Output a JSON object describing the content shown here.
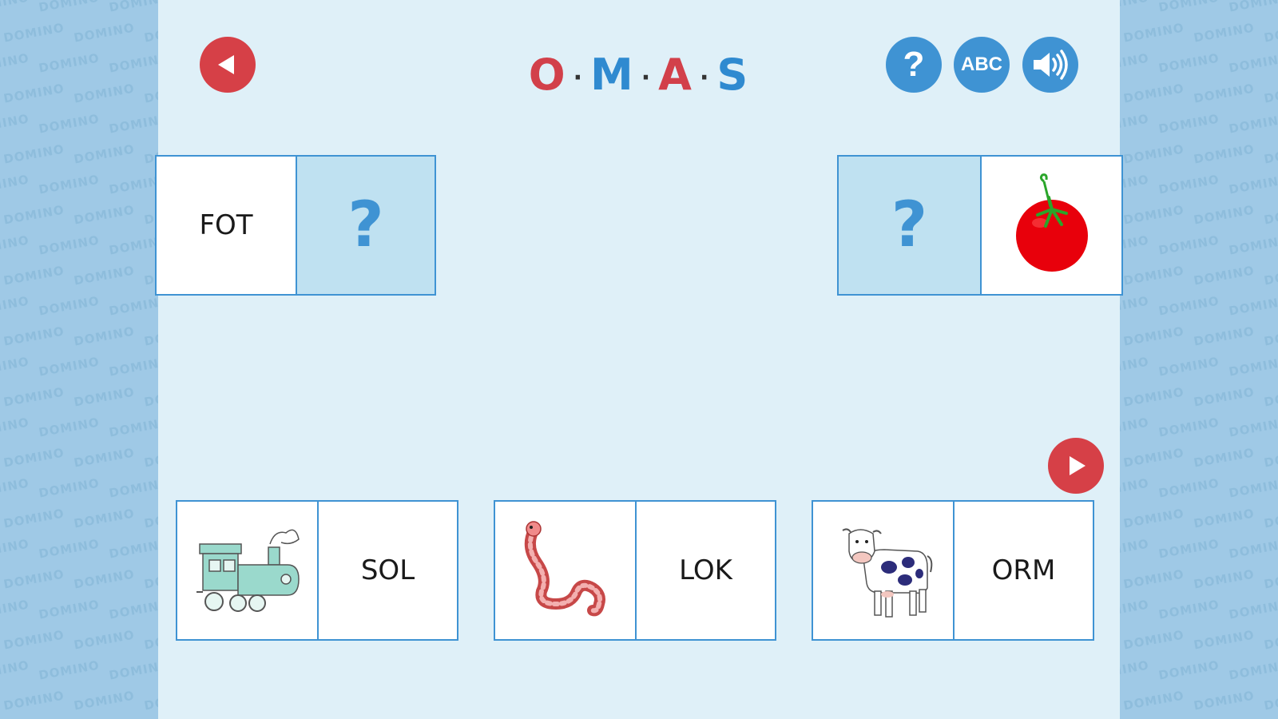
{
  "background": {
    "watermark_text": "DOMINO",
    "colors": {
      "side_panel": "#9fc9e6",
      "main_panel": "#dff0f8",
      "accent_blue": "#3f93d3",
      "accent_red": "#d64047"
    }
  },
  "header": {
    "back_icon": "triangle-left-icon",
    "title_letters": [
      "O",
      "M",
      "A",
      "S"
    ],
    "title_separator": "·",
    "help_label": "?",
    "abc_label": "ABC",
    "sound_icon": "speaker-icon"
  },
  "board": {
    "left_tile": {
      "word": "FOT",
      "placeholder": "?"
    },
    "right_tile": {
      "placeholder": "?",
      "image": "tomato"
    }
  },
  "choices": [
    {
      "image": "train",
      "word": "SOL"
    },
    {
      "image": "worm",
      "word": "LOK"
    },
    {
      "image": "cow",
      "word": "ORM"
    }
  ],
  "next_icon": "triangle-right-icon"
}
